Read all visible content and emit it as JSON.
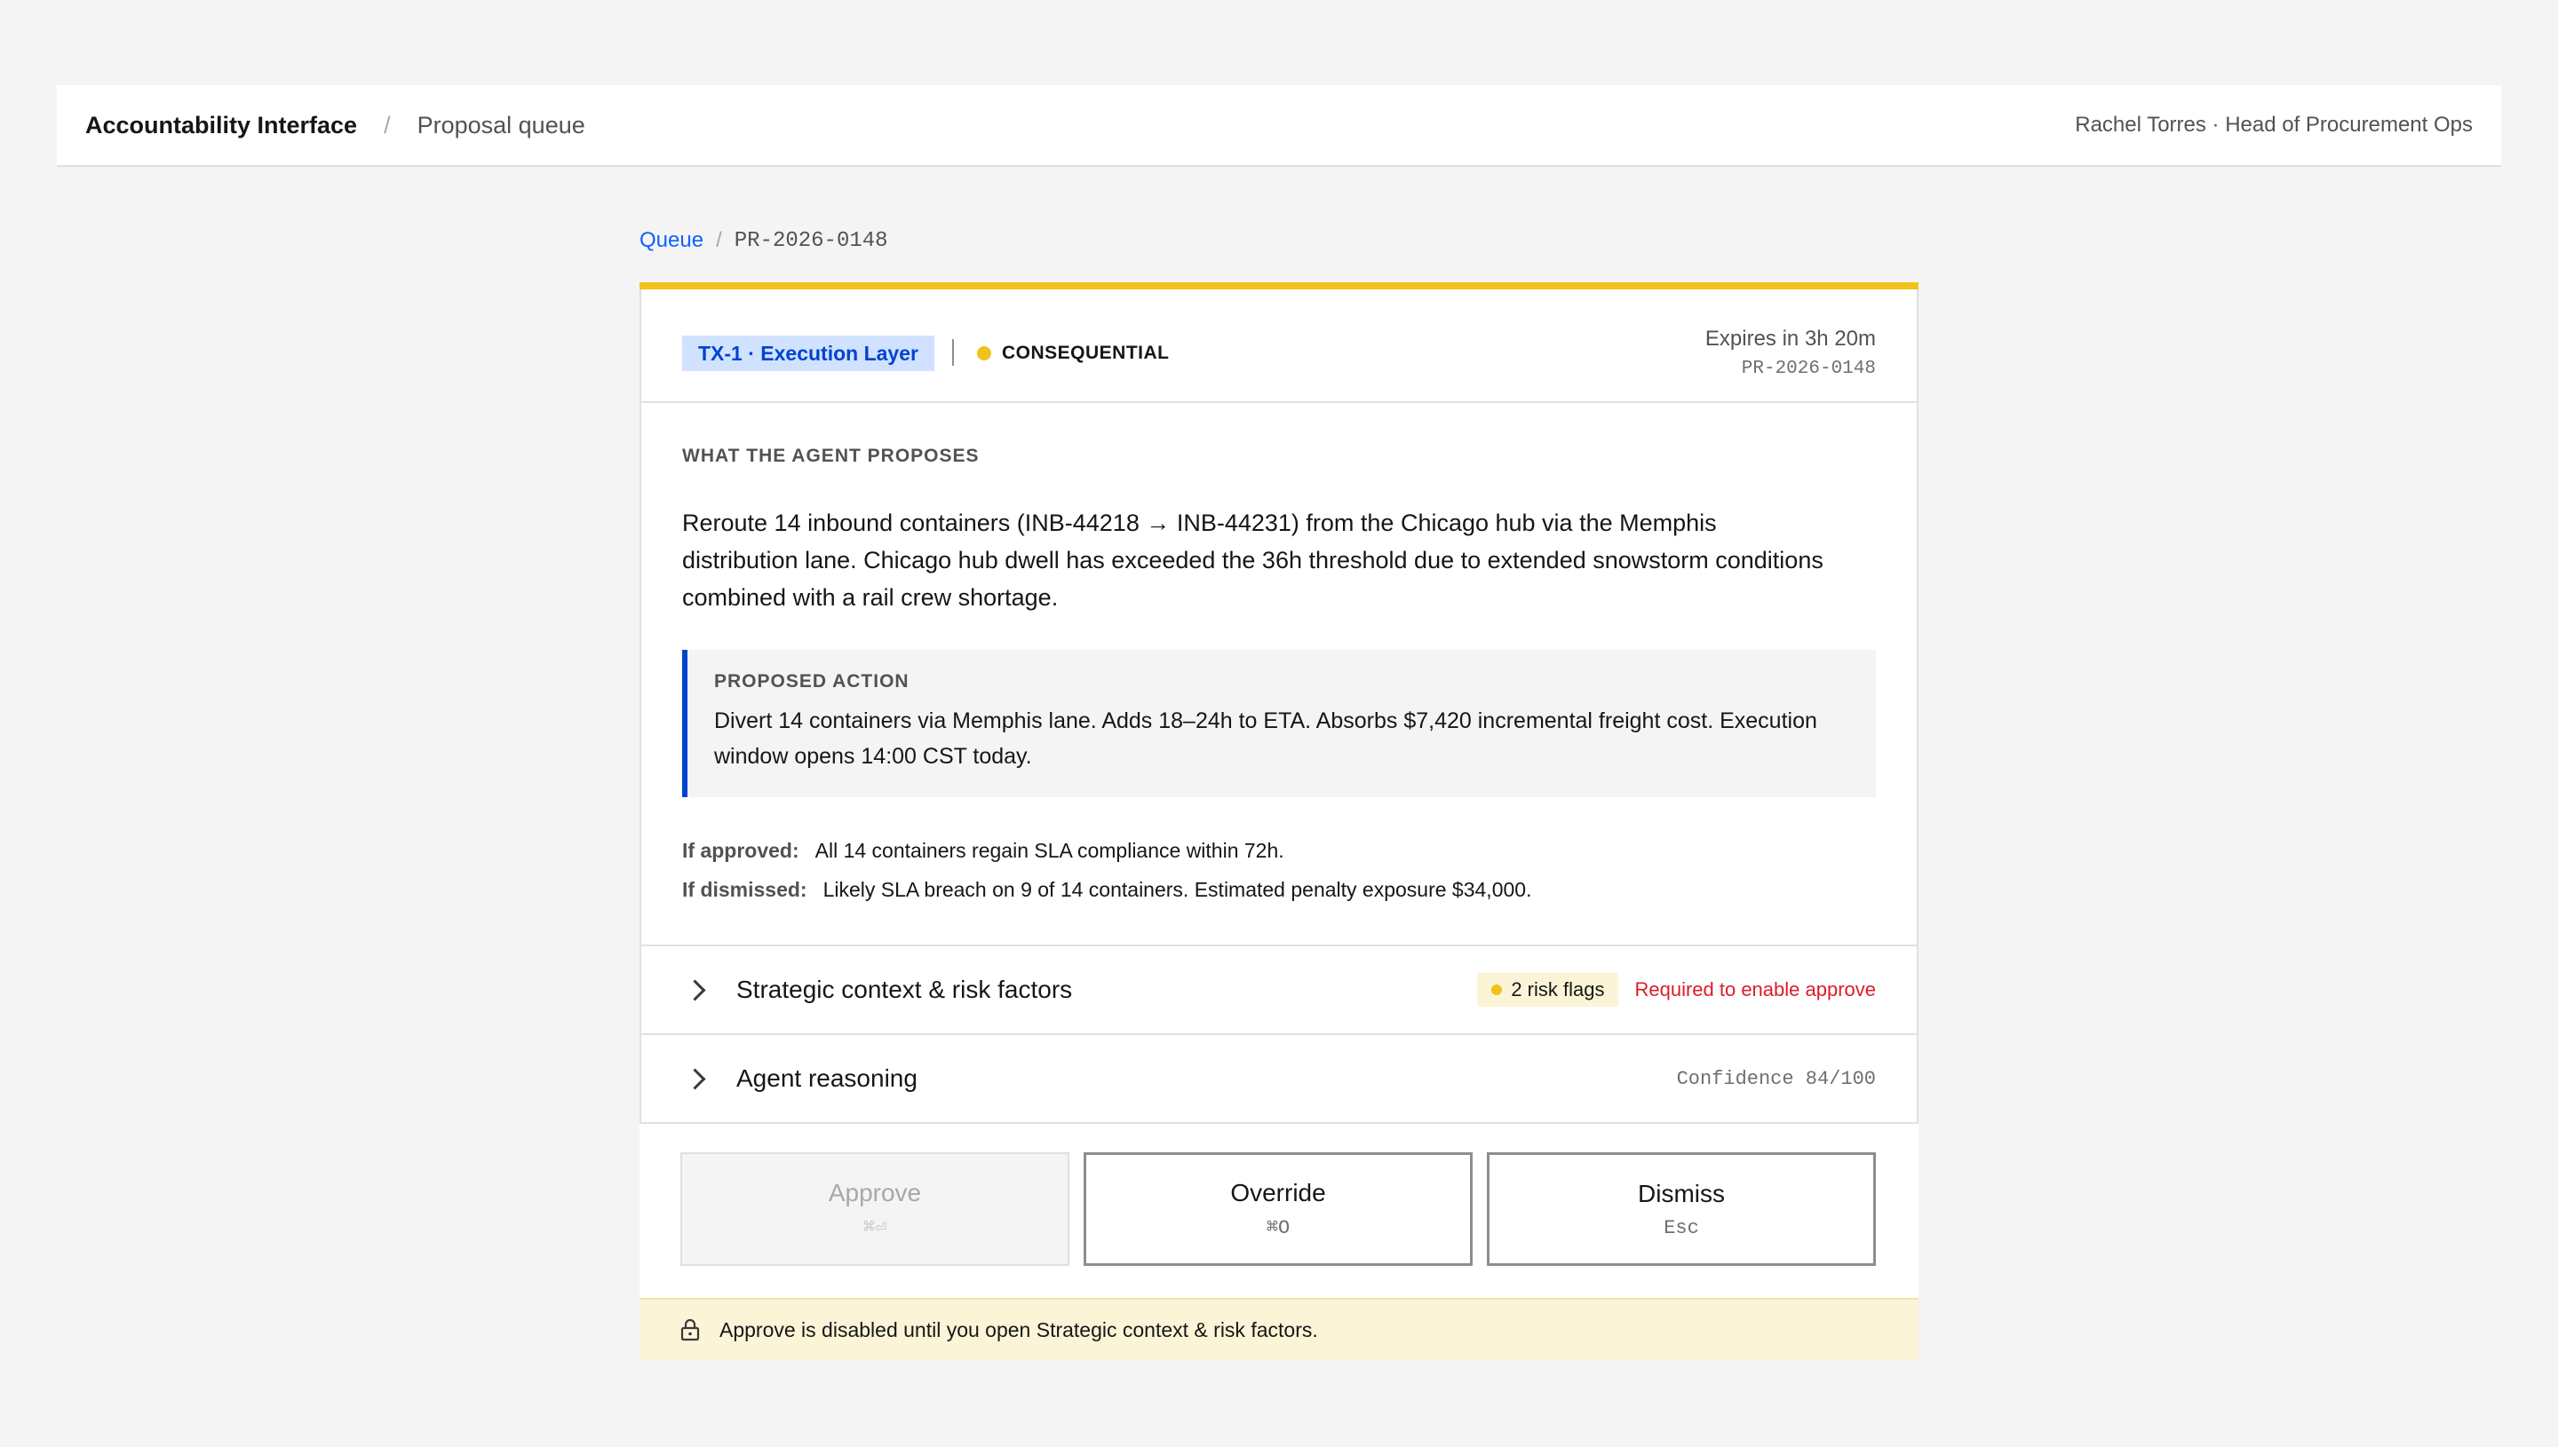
{
  "app": {
    "title": "Accountability Interface",
    "separator": "/",
    "section": "Proposal queue",
    "user": "Rachel Torres · Head of Procurement Ops"
  },
  "breadcrumb": {
    "root": "Queue",
    "separator": "/",
    "current": "PR-2026-0148"
  },
  "colors": {
    "accent_warning": "#f1c21b",
    "brand_blue": "#0043ce",
    "link_blue": "#0f62fe",
    "danger": "#da1e28",
    "risk_bg": "#fcf4d6"
  },
  "card": {
    "tier": "TX-1 · Execution Layer",
    "severity": "CONSEQUENTIAL",
    "expires": "Expires in 3h 20m",
    "id": "PR-2026-0148",
    "proposal_label": "WHAT THE AGENT PROPOSES",
    "proposal_text": "Reroute 14 inbound containers (INB-44218 → INB-44231) from the Chicago hub via the Memphis distribution lane. Chicago hub dwell has exceeded the 36h threshold due to extended snowstorm conditions combined with a rail crew shortage.",
    "action_label": "PROPOSED ACTION",
    "action_text": "Divert 14 containers via Memphis lane. Adds 18–24h to ETA. Absorbs $7,420 incremental freight cost. Execution window opens 14:00 CST today.",
    "if_approved_label": "If approved:",
    "if_approved_text": "All 14 containers regain SLA compliance within 72h.",
    "if_dismissed_label": "If dismissed:",
    "if_dismissed_text": "Likely SLA breach on 9 of 14 containers. Estimated penalty exposure $34,000."
  },
  "accordions": {
    "strategic": {
      "title": "Strategic context & risk factors",
      "risk_flags": "2 risk flags",
      "required": "Required to enable approve",
      "icon": "chevron-right-icon"
    },
    "reasoning": {
      "title": "Agent reasoning",
      "confidence": "Confidence 84/100",
      "icon": "chevron-right-icon"
    }
  },
  "buttons": {
    "approve": {
      "label": "Approve",
      "shortcut": "⌘⏎",
      "disabled": true
    },
    "override": {
      "label": "Override",
      "shortcut": "⌘O"
    },
    "dismiss": {
      "label": "Dismiss",
      "shortcut": "Esc"
    }
  },
  "notice": {
    "text": "Approve is disabled until you open Strategic context & risk factors.",
    "icon": "lock-icon"
  }
}
